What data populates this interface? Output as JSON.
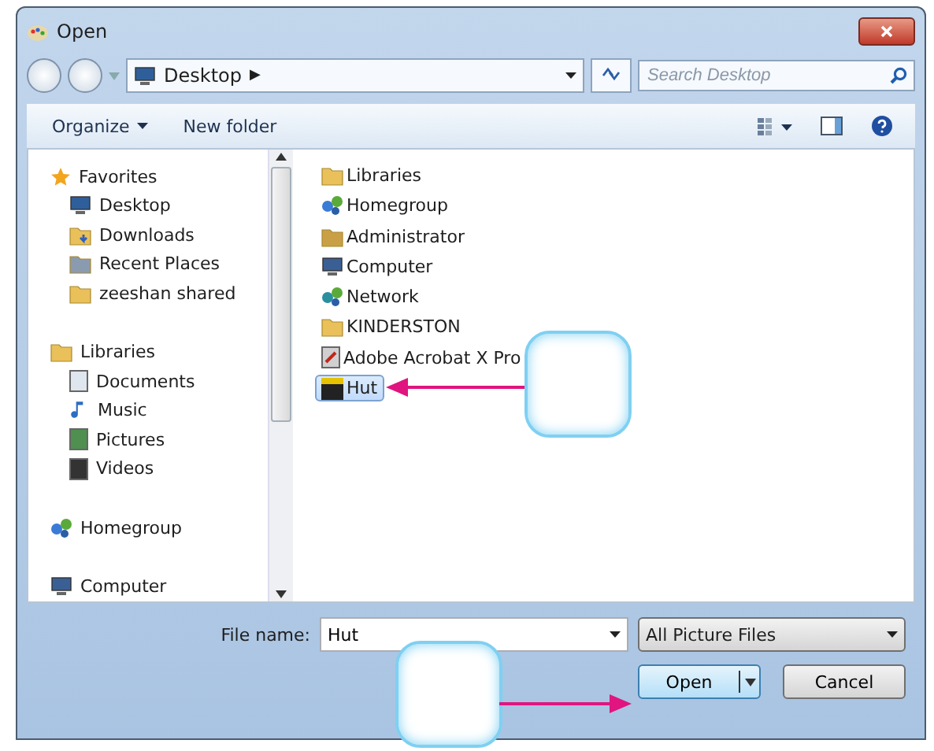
{
  "window": {
    "title": "Open"
  },
  "address": {
    "location": "Desktop",
    "separator": "▶"
  },
  "search": {
    "placeholder": "Search Desktop"
  },
  "toolbar": {
    "organize": "Organize",
    "new_folder": "New folder"
  },
  "sidebar": {
    "groups": [
      {
        "label": "Favorites",
        "children": [
          {
            "label": "Desktop"
          },
          {
            "label": "Downloads"
          },
          {
            "label": "Recent Places"
          },
          {
            "label": "zeeshan shared"
          }
        ]
      },
      {
        "label": "Libraries",
        "children": [
          {
            "label": "Documents"
          },
          {
            "label": "Music"
          },
          {
            "label": "Pictures"
          },
          {
            "label": "Videos"
          }
        ]
      },
      {
        "label": "Homegroup"
      },
      {
        "label": "Computer"
      }
    ]
  },
  "files": [
    {
      "name": "Libraries",
      "selected": false
    },
    {
      "name": "Homegroup",
      "selected": false
    },
    {
      "name": "Administrator",
      "selected": false
    },
    {
      "name": "Computer",
      "selected": false
    },
    {
      "name": "Network",
      "selected": false
    },
    {
      "name": "KINDERSTON",
      "selected": false
    },
    {
      "name": "Adobe Acrobat X Pro",
      "selected": false
    },
    {
      "name": "Hut",
      "selected": true
    }
  ],
  "footer": {
    "file_name_label": "File name:",
    "file_name": "Hut",
    "file_type": "All Picture Files",
    "open": "Open",
    "cancel": "Cancel"
  }
}
